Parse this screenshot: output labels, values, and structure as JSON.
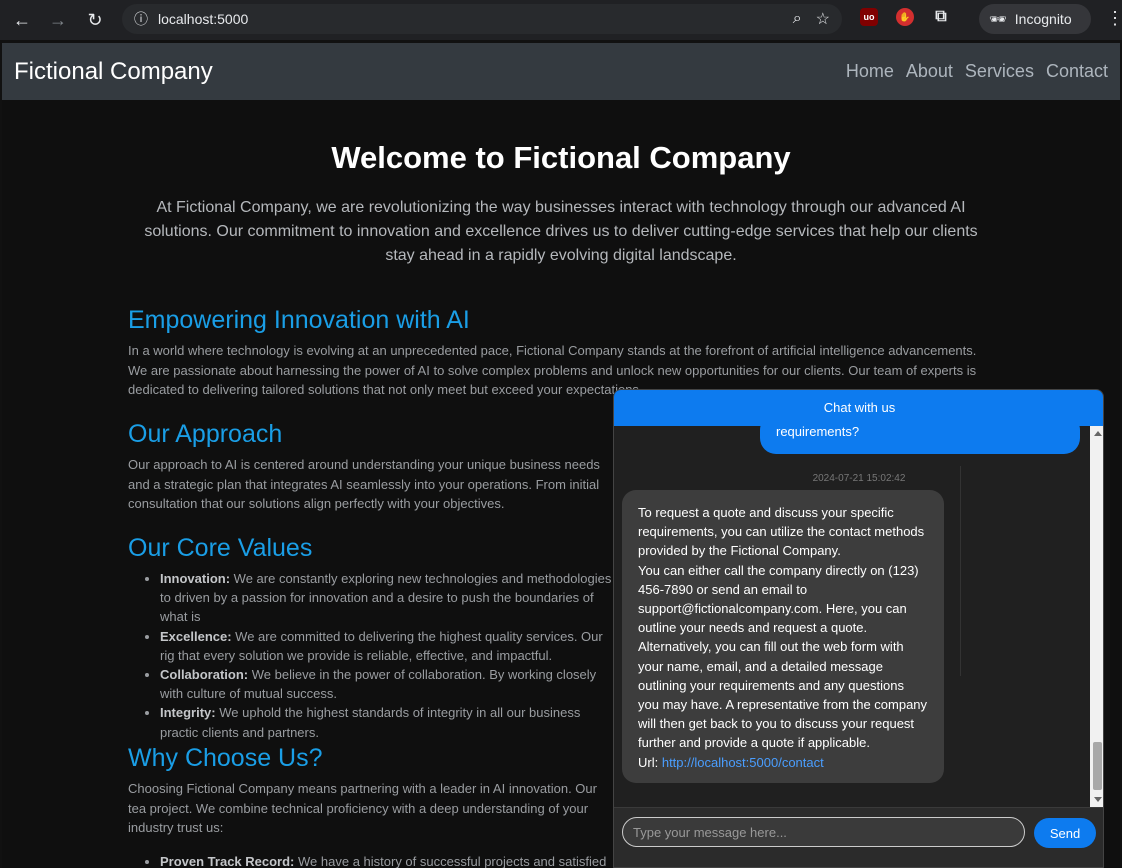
{
  "browser": {
    "url": "localhost:5000",
    "incognito_label": "Incognito"
  },
  "navbar": {
    "brand": "Fictional Company",
    "links": [
      "Home",
      "About",
      "Services",
      "Contact"
    ]
  },
  "hero": {
    "title": "Welcome to Fictional Company",
    "text": "At Fictional Company, we are revolutionizing the way businesses interact with technology through our advanced AI solutions. Our commitment to innovation and excellence drives us to deliver cutting-edge services that help our clients stay ahead in a rapidly evolving digital landscape."
  },
  "sections": {
    "innovation": {
      "title": "Empowering Innovation with AI",
      "text": "In a world where technology is evolving at an unprecedented pace, Fictional Company stands at the forefront of artificial intelligence advancements. We are passionate about harnessing the power of AI to solve complex problems and unlock new opportunities for our clients. Our team of experts is dedicated to delivering tailored solutions that not only meet but exceed your expectations."
    },
    "approach": {
      "title": "Our Approach",
      "text": "Our approach to AI is centered around understanding your unique business needs and a strategic plan that integrates AI seamlessly into your operations. From initial consultation that our solutions align perfectly with your objectives."
    },
    "values": {
      "title": "Our Core Values",
      "items": [
        {
          "label": "Innovation:",
          "text": "We are constantly exploring new technologies and methodologies to driven by a passion for innovation and a desire to push the boundaries of what is"
        },
        {
          "label": "Excellence:",
          "text": "We are committed to delivering the highest quality services. Our rig that every solution we provide is reliable, effective, and impactful."
        },
        {
          "label": "Collaboration:",
          "text": "We believe in the power of collaboration. By working closely with culture of mutual success."
        },
        {
          "label": "Integrity:",
          "text": "We uphold the highest standards of integrity in all our business practic clients and partners."
        }
      ]
    },
    "why": {
      "title": "Why Choose Us?",
      "text": "Choosing Fictional Company means partnering with a leader in AI innovation. Our tea project. We combine technical proficiency with a deep understanding of your industry trust us:",
      "items": [
        {
          "label": "Proven Track Record:",
          "text": "We have a history of successful projects and satisfied cl"
        }
      ]
    }
  },
  "chat": {
    "header": "Chat with us",
    "user_message_tail": "requirements?",
    "timestamp": "2024-07-21 15:02:42",
    "bot_lines": [
      "To request a quote and discuss your specific requirements, you can utilize the contact methods provided by the Fictional Company.",
      "You can either call the company directly on (123) 456-7890 or send an email to support@fictionalcompany.com. Here, you can outline your needs and request a quote. Alternatively, you can fill out the web form with your name, email, and a detailed message outlining your requirements and any questions you may have. A representative from the company will then get back to you to discuss your request further and provide a quote if applicable."
    ],
    "url_label": "Url:",
    "url": "http://localhost:5000/contact",
    "input_placeholder": "Type your message here...",
    "send_label": "Send"
  },
  "colors": {
    "accent": "#0d7bef",
    "heading": "#1a9ee6",
    "navbar_bg": "#343a40"
  }
}
